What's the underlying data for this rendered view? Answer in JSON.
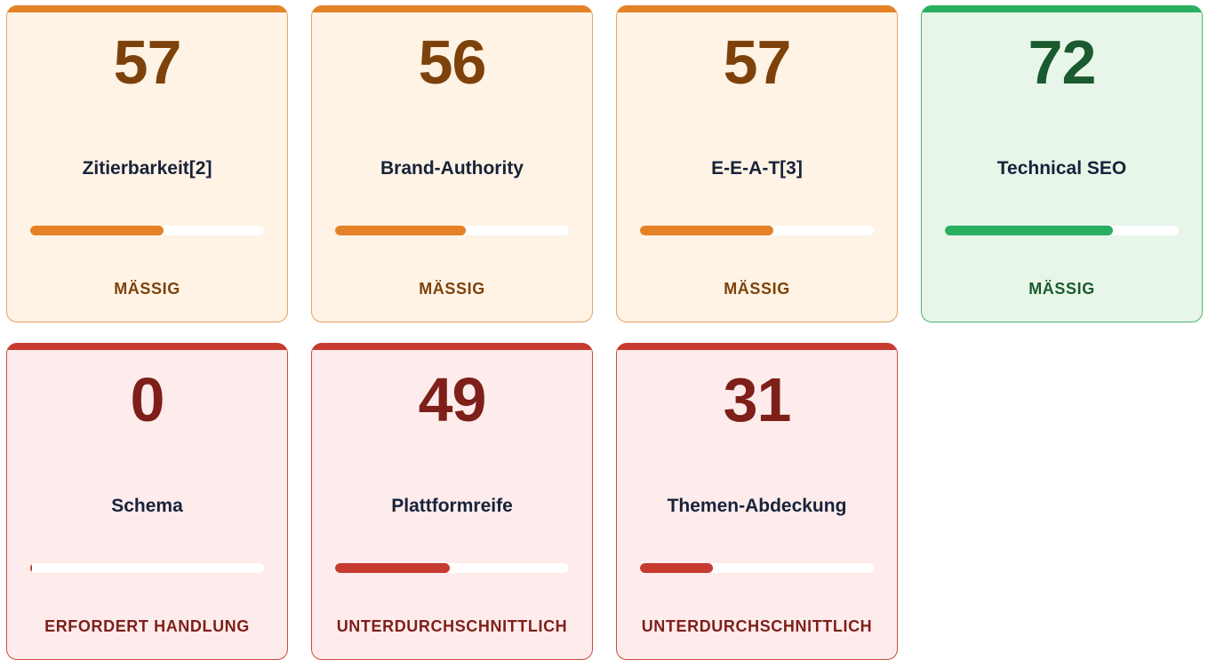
{
  "colors": {
    "orange_accent": "#e48127",
    "green_accent": "#28b060",
    "red_accent": "#c63a2f"
  },
  "cards": [
    {
      "score": "57",
      "label": "Zitierbarkeit[2]",
      "progress": 0.57,
      "status": "MÄSSIG",
      "tone": "orange"
    },
    {
      "score": "56",
      "label": "Brand-Authority",
      "progress": 0.56,
      "status": "MÄSSIG",
      "tone": "orange"
    },
    {
      "score": "57",
      "label": "E-E-A-T[3]",
      "progress": 0.57,
      "status": "MÄSSIG",
      "tone": "orange"
    },
    {
      "score": "72",
      "label": "Technical SEO",
      "progress": 0.72,
      "status": "MÄSSIG",
      "tone": "green"
    },
    {
      "score": "0",
      "label": "Schema",
      "progress": 0.0,
      "status": "ERFORDERT HANDLUNG",
      "tone": "red"
    },
    {
      "score": "49",
      "label": "Plattformreife",
      "progress": 0.49,
      "status": "UNTERDURCHSCHNITTLICH",
      "tone": "red"
    },
    {
      "score": "31",
      "label": "Themen-Abdeckung",
      "progress": 0.31,
      "status": "UNTERDURCHSCHNITTLICH",
      "tone": "red"
    }
  ]
}
